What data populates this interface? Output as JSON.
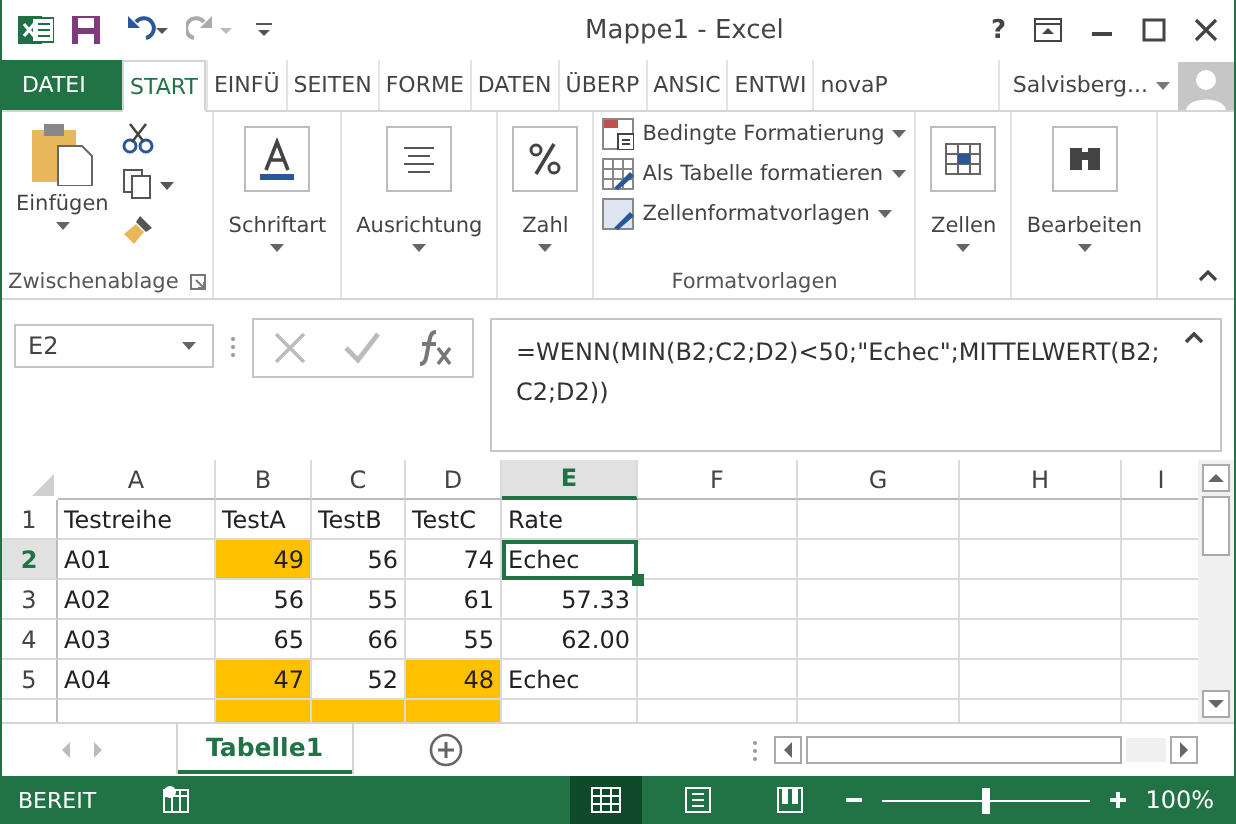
{
  "window": {
    "title": "Mappe1 - Excel",
    "help": "?"
  },
  "tabs": [
    {
      "label": "DATEI",
      "kind": "file",
      "selected": false
    },
    {
      "label": "START",
      "kind": "tab",
      "selected": true
    },
    {
      "label": "EINFÜ",
      "kind": "tab",
      "selected": false
    },
    {
      "label": "SEITEN",
      "kind": "tab",
      "selected": false
    },
    {
      "label": "FORME",
      "kind": "tab",
      "selected": false
    },
    {
      "label": "DATEN",
      "kind": "tab",
      "selected": false
    },
    {
      "label": "ÜBERP",
      "kind": "tab",
      "selected": false
    },
    {
      "label": "ANSIC",
      "kind": "tab",
      "selected": false
    },
    {
      "label": "ENTWI",
      "kind": "tab",
      "selected": false
    },
    {
      "label": "novaP",
      "kind": "tab",
      "selected": false
    }
  ],
  "user": {
    "name": "Salvisberg..."
  },
  "ribbon": {
    "clipboard": {
      "paste": "Einfügen",
      "group": "Zwischenablage"
    },
    "buttons": [
      {
        "label": "Schriftart",
        "kind": "font"
      },
      {
        "label": "Ausrichtung",
        "kind": "align"
      },
      {
        "label": "Zahl",
        "kind": "number"
      }
    ],
    "styles": {
      "items": [
        "Bedingte Formatierung",
        "Als Tabelle formatieren",
        "Zellenformatvorlagen"
      ],
      "group": "Formatvorlagen"
    },
    "more": [
      {
        "label": "Zellen",
        "kind": "cells"
      },
      {
        "label": "Bearbeiten",
        "kind": "find"
      }
    ]
  },
  "formula_bar": {
    "name_box": "E2",
    "formula": "=WENN(MIN(B2;C2;D2)<50;\"Echec\";MITTELWERT(B2;C2;D2))"
  },
  "sheet": {
    "columns": [
      {
        "label": "A",
        "selected": false
      },
      {
        "label": "B",
        "selected": false
      },
      {
        "label": "C",
        "selected": false
      },
      {
        "label": "D",
        "selected": false
      },
      {
        "label": "E",
        "selected": true
      },
      {
        "label": "F",
        "selected": false
      },
      {
        "label": "G",
        "selected": false
      },
      {
        "label": "H",
        "selected": false
      },
      {
        "label": "I",
        "selected": false
      }
    ],
    "rows": [
      {
        "number": "1",
        "selected": false,
        "cells": [
          {
            "text": "Testreihe",
            "kind": "text",
            "highlighted": false,
            "selected": false
          },
          {
            "text": "TestA",
            "kind": "text",
            "highlighted": false,
            "selected": false
          },
          {
            "text": "TestB",
            "kind": "text",
            "highlighted": false,
            "selected": false
          },
          {
            "text": "TestC",
            "kind": "text",
            "highlighted": false,
            "selected": false
          },
          {
            "text": "Rate",
            "kind": "text",
            "highlighted": false,
            "selected": false
          }
        ]
      },
      {
        "number": "2",
        "selected": true,
        "cells": [
          {
            "text": "A01",
            "kind": "text",
            "highlighted": false,
            "selected": false
          },
          {
            "text": "49",
            "kind": "number",
            "highlighted": true,
            "selected": false
          },
          {
            "text": "56",
            "kind": "number",
            "highlighted": false,
            "selected": false
          },
          {
            "text": "74",
            "kind": "number",
            "highlighted": false,
            "selected": false
          },
          {
            "text": "Echec",
            "kind": "text",
            "highlighted": false,
            "selected": true
          }
        ]
      },
      {
        "number": "3",
        "selected": false,
        "cells": [
          {
            "text": "A02",
            "kind": "text",
            "highlighted": false,
            "selected": false
          },
          {
            "text": "56",
            "kind": "number",
            "highlighted": false,
            "selected": false
          },
          {
            "text": "55",
            "kind": "number",
            "highlighted": false,
            "selected": false
          },
          {
            "text": "61",
            "kind": "number",
            "highlighted": false,
            "selected": false
          },
          {
            "text": "57.33",
            "kind": "number",
            "highlighted": false,
            "selected": false
          }
        ]
      },
      {
        "number": "4",
        "selected": false,
        "cells": [
          {
            "text": "A03",
            "kind": "text",
            "highlighted": false,
            "selected": false
          },
          {
            "text": "65",
            "kind": "number",
            "highlighted": false,
            "selected": false
          },
          {
            "text": "66",
            "kind": "number",
            "highlighted": false,
            "selected": false
          },
          {
            "text": "55",
            "kind": "number",
            "highlighted": false,
            "selected": false
          },
          {
            "text": "62.00",
            "kind": "number",
            "highlighted": false,
            "selected": false
          }
        ]
      },
      {
        "number": "5",
        "selected": false,
        "cells": [
          {
            "text": "A04",
            "kind": "text",
            "highlighted": false,
            "selected": false
          },
          {
            "text": "47",
            "kind": "number",
            "highlighted": true,
            "selected": false
          },
          {
            "text": "52",
            "kind": "number",
            "highlighted": false,
            "selected": false
          },
          {
            "text": "48",
            "kind": "number",
            "highlighted": true,
            "selected": false
          },
          {
            "text": "Echec",
            "kind": "text",
            "highlighted": false,
            "selected": false
          }
        ]
      },
      {
        "cells": [
          {
            "kind": "text",
            "highlighted": false,
            "selected": false
          },
          {
            "kind": "number",
            "highlighted": true,
            "selected": false
          },
          {
            "kind": "number",
            "highlighted": true,
            "selected": false
          },
          {
            "kind": "number",
            "highlighted": true,
            "selected": false
          }
        ]
      }
    ]
  },
  "sheet_tabs": [
    {
      "label": "Tabelle1",
      "selected": true
    }
  ],
  "status_bar": {
    "mode": "BEREIT",
    "zoom": "100%",
    "zoom_level": {
      "level": 0.5
    }
  }
}
